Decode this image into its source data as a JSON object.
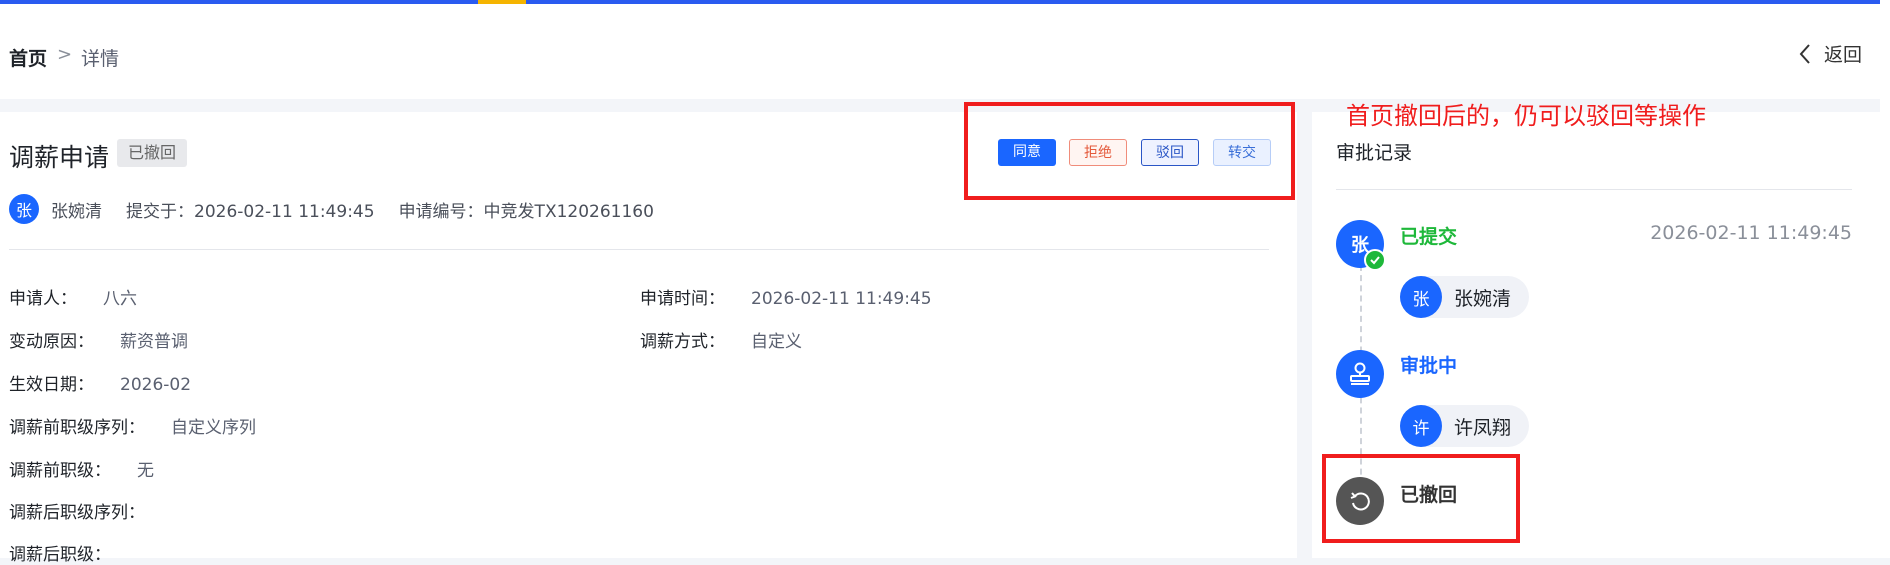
{
  "breadcrumb": {
    "home": "首页",
    "separator": ">",
    "current": "详情"
  },
  "header": {
    "back_label": "返回",
    "back_icon": "chevron-left-icon"
  },
  "request": {
    "title": "调薪申请",
    "status": "已撤回",
    "applicant_initial": "张",
    "applicant_name": "张婉清",
    "submitted_at": "提交于：2026-02-11 11:49:45",
    "serial": "申请编号：中竞发TX120261160"
  },
  "actions": {
    "agree": "同意",
    "reject": "拒绝",
    "return": "驳回",
    "transfer": "转交"
  },
  "fields": {
    "applicant": {
      "label": "申请人：",
      "value": "八六"
    },
    "apply_time": {
      "label": "申请时间：",
      "value": "2026-02-11 11:49:45"
    },
    "reason": {
      "label": "变动原因：",
      "value": "薪资普调"
    },
    "method": {
      "label": "调薪方式：",
      "value": "自定义"
    },
    "effective": {
      "label": "生效日期：",
      "value": "2026-02"
    },
    "pre_sequence": {
      "label": "调薪前职级序列：",
      "value": "自定义序列"
    },
    "pre_level": {
      "label": "调薪前职级：",
      "value": "无"
    },
    "post_sequence": {
      "label": "调薪后职级序列：",
      "value": ""
    },
    "post_level": {
      "label": "调薪后职级：",
      "value": ""
    }
  },
  "annotation": "首页撤回后的，仍可以驳回等操作",
  "records": {
    "title": "审批记录",
    "steps": [
      {
        "initial": "张",
        "label": "已提交",
        "time": "2026-02-11 11:49:45",
        "person_initial": "张",
        "person_name": "张婉清",
        "color": "#1eb83a"
      },
      {
        "label": "审批中",
        "person_initial": "许",
        "person_name": "许凤翔",
        "color": "#1a66ff"
      },
      {
        "label": "已撤回",
        "color": "#333333"
      }
    ]
  },
  "colors": {
    "primary": "#1a66ff",
    "annotation_red": "#f01d1d",
    "success": "#1eb83a",
    "danger": "#e4593b"
  }
}
